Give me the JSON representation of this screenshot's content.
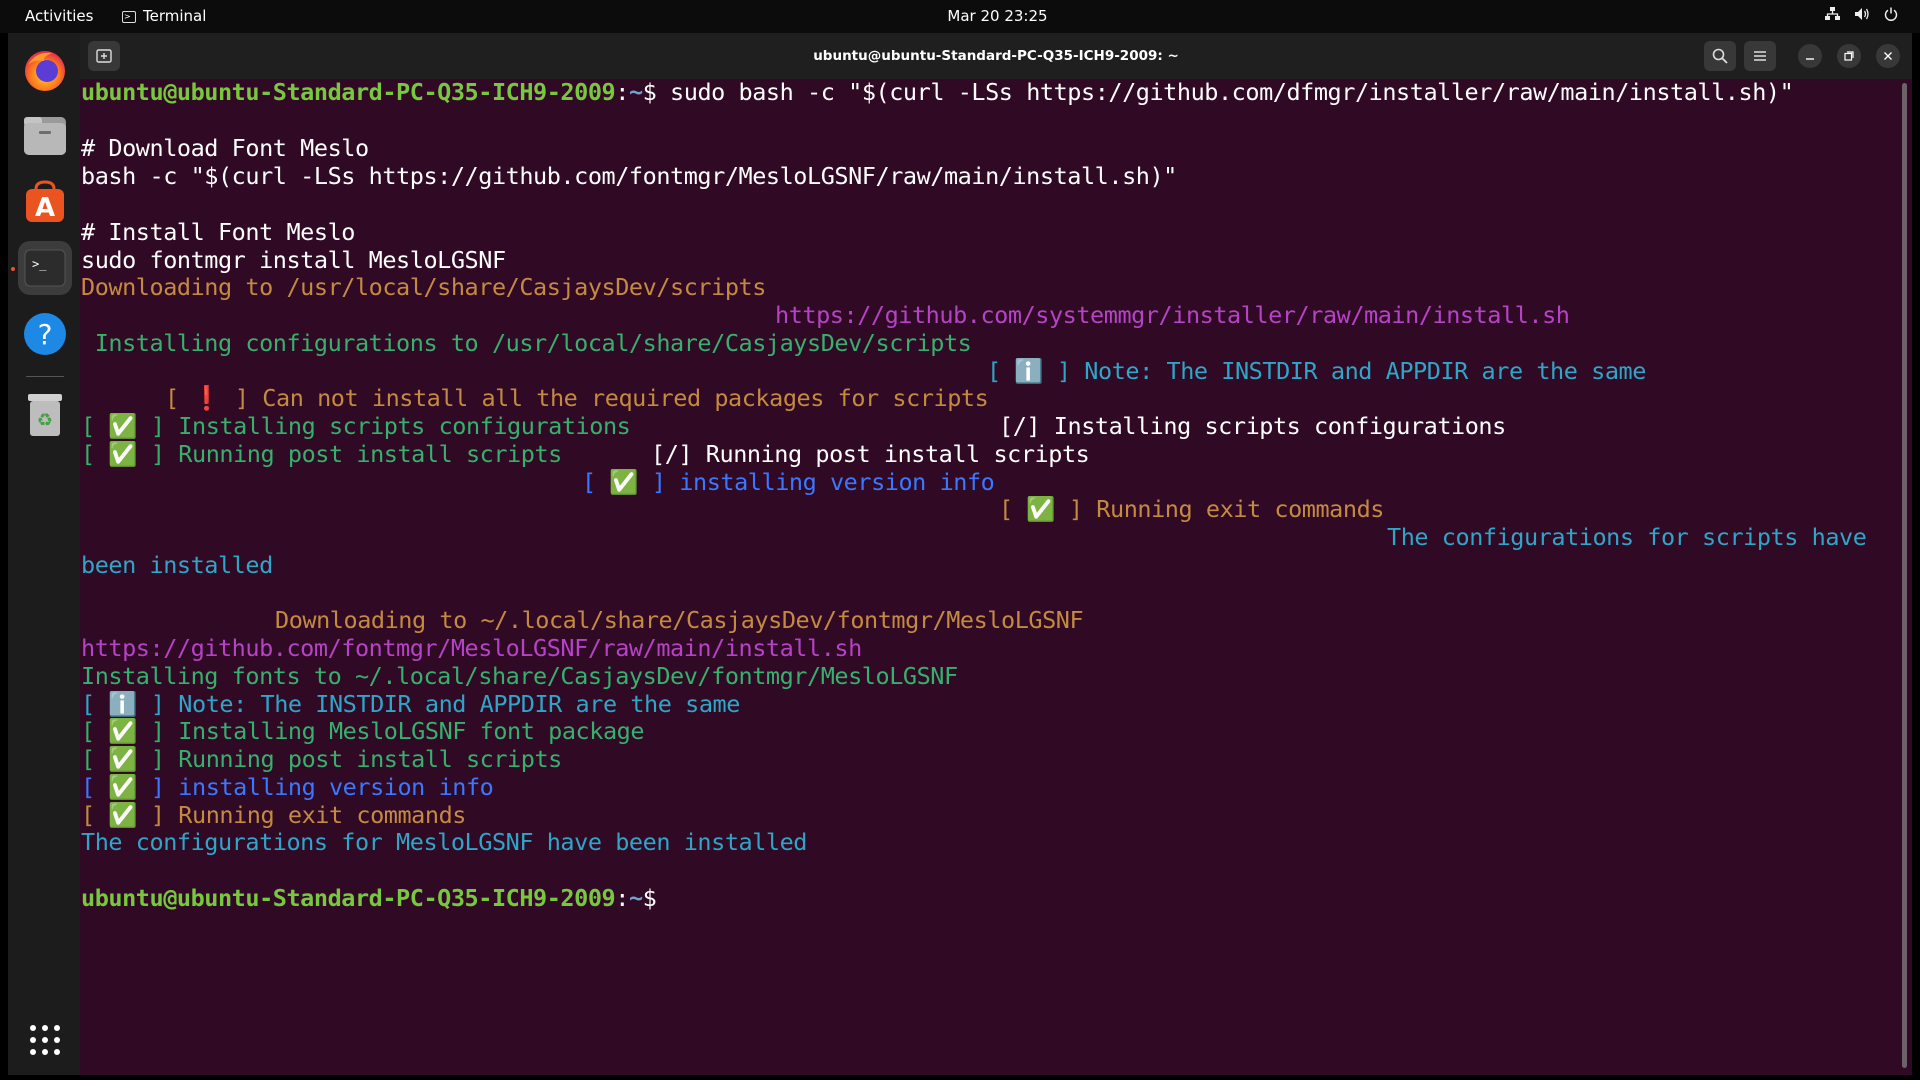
{
  "topbar": {
    "activities": "Activities",
    "app_name": "Terminal",
    "clock": "Mar 20  23:25"
  },
  "dock": {
    "items": [
      "firefox-icon",
      "files-icon",
      "app-center-icon",
      "terminal-icon",
      "help-icon",
      "trash-icon",
      "show-apps-icon"
    ],
    "active": "terminal-icon"
  },
  "window": {
    "title": "ubuntu@ubuntu-Standard-PC-Q35-ICH9-2009: ~"
  },
  "prompt": {
    "user": "ubuntu@ubuntu-Standard-PC-Q35-ICH9-2009",
    "sep": ":",
    "path": "~",
    "sym": "$ "
  },
  "terminal": {
    "command": "sudo bash -c \"$(curl -LSs https://github.com/dfmgr/installer/raw/main/install.sh)\"",
    "l3": "# Download Font Meslo",
    "l4": "bash -c \"$(curl -LSs https://github.com/fontmgr/MesloLGSNF/raw/main/install.sh)\"",
    "l6": "# Install Font Meslo",
    "l7": "sudo fontmgr install MesloLGSNF",
    "l8": "Downloading to /usr/local/share/CasjaysDev/scripts",
    "l9": "https://github.com/systemmgr/installer/raw/main/install.sh",
    "l10": " Installing configurations to /usr/local/share/CasjaysDev/scripts",
    "l11": "[ ℹ️ ] Note: The INSTDIR and APPDIR are the same",
    "l12": "[ ❗ ] Can not install all the required packages for scripts",
    "l13a": "[ ✅ ] Installing scripts configurations",
    "l13b": "[/] Installing scripts configurations",
    "l14a": "[ ✅ ] Running post install scripts",
    "l14b": "[/] Running post install scripts",
    "l15": "[ ✅ ] installing version info",
    "l16": "[ ✅ ] Running exit commands",
    "l17": "The configurations for scripts have",
    "l18": "been installed",
    "l20": "Downloading to ~/.local/share/CasjaysDev/fontmgr/MesloLGSNF",
    "l21": "https://github.com/fontmgr/MesloLGSNF/raw/main/install.sh",
    "l22": "Installing fonts to ~/.local/share/CasjaysDev/fontmgr/MesloLGSNF",
    "l23": "[ ℹ️ ] Note: The INSTDIR and APPDIR are the same",
    "l24": "[ ✅ ] Installing MesloLGSNF font package",
    "l25": "[ ✅ ] Running post install scripts",
    "l26": "[ ✅ ] installing version info",
    "l27": "[ ✅ ] Running exit commands",
    "l28": "The configurations for MesloLGSNF have been installed"
  },
  "colors": {
    "terminal_bg": "#300a24",
    "prompt_user": "#78c83f",
    "prompt_path": "#729fcf",
    "orange": "#c48a41",
    "magenta": "#b542c7",
    "green": "#36b06d",
    "cyan": "#2fa5c8",
    "blue": "#3b78ff"
  }
}
